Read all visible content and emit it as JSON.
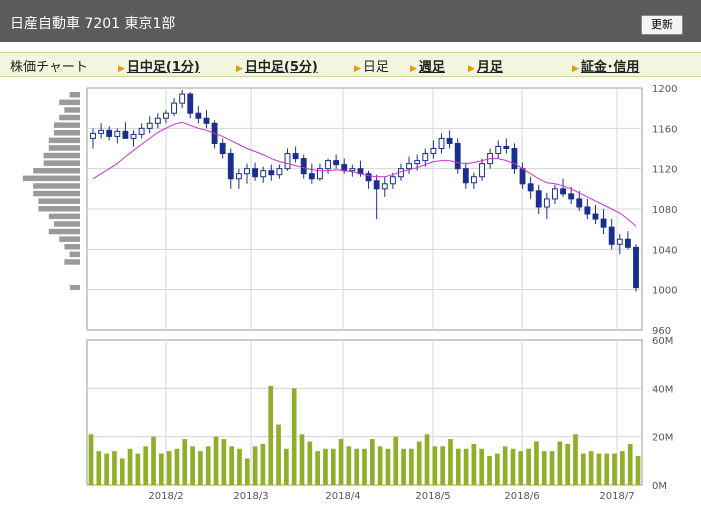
{
  "header": {
    "title": "日産自動車  7201  東京1部",
    "refresh_label": "更新"
  },
  "nav": {
    "label": "株価チャート",
    "items": [
      {
        "label": "日中足(1分)",
        "active": false
      },
      {
        "label": "日中足(5分)",
        "active": false
      },
      {
        "label": "日足",
        "active": true
      },
      {
        "label": "週足",
        "active": false
      },
      {
        "label": "月足",
        "active": false
      },
      {
        "label": "証金･信用",
        "active": false
      }
    ]
  },
  "chart_data": [
    {
      "type": "candlestick",
      "yticks": [
        "1200",
        "1160",
        "1120",
        "1080",
        "1040",
        "1000",
        "960"
      ],
      "ylim": [
        960,
        1200
      ],
      "xticks": [
        "2018/2",
        "2018/3",
        "2018/4",
        "2018/5",
        "2018/6",
        "2018/7"
      ],
      "colors": {
        "up": "#ffffff",
        "down": "#1a2f8c",
        "ma": "#cc33cc"
      },
      "ohlc": [
        [
          1150,
          1160,
          1140,
          1155
        ],
        [
          1155,
          1165,
          1150,
          1158
        ],
        [
          1158,
          1162,
          1148,
          1152
        ],
        [
          1152,
          1160,
          1145,
          1157
        ],
        [
          1157,
          1166,
          1152,
          1150
        ],
        [
          1150,
          1158,
          1142,
          1154
        ],
        [
          1154,
          1165,
          1150,
          1160
        ],
        [
          1160,
          1172,
          1155,
          1165
        ],
        [
          1165,
          1175,
          1160,
          1170
        ],
        [
          1170,
          1178,
          1165,
          1175
        ],
        [
          1175,
          1190,
          1172,
          1185
        ],
        [
          1185,
          1198,
          1180,
          1194
        ],
        [
          1194,
          1196,
          1170,
          1175
        ],
        [
          1175,
          1182,
          1165,
          1170
        ],
        [
          1170,
          1178,
          1160,
          1165
        ],
        [
          1165,
          1168,
          1140,
          1145
        ],
        [
          1145,
          1150,
          1130,
          1135
        ],
        [
          1135,
          1140,
          1100,
          1110
        ],
        [
          1110,
          1120,
          1100,
          1115
        ],
        [
          1115,
          1125,
          1105,
          1120
        ],
        [
          1120,
          1126,
          1108,
          1112
        ],
        [
          1112,
          1122,
          1106,
          1118
        ],
        [
          1118,
          1124,
          1108,
          1114
        ],
        [
          1114,
          1124,
          1110,
          1120
        ],
        [
          1120,
          1140,
          1118,
          1135
        ],
        [
          1135,
          1142,
          1126,
          1130
        ],
        [
          1130,
          1134,
          1110,
          1115
        ],
        [
          1115,
          1125,
          1105,
          1110
        ],
        [
          1110,
          1125,
          1108,
          1120
        ],
        [
          1120,
          1130,
          1115,
          1128
        ],
        [
          1128,
          1134,
          1120,
          1124
        ],
        [
          1124,
          1130,
          1115,
          1118
        ],
        [
          1118,
          1124,
          1112,
          1120
        ],
        [
          1120,
          1128,
          1112,
          1115
        ],
        [
          1115,
          1118,
          1100,
          1108
        ],
        [
          1108,
          1114,
          1070,
          1100
        ],
        [
          1100,
          1112,
          1092,
          1105
        ],
        [
          1105,
          1116,
          1100,
          1112
        ],
        [
          1112,
          1125,
          1108,
          1120
        ],
        [
          1120,
          1132,
          1115,
          1125
        ],
        [
          1125,
          1134,
          1118,
          1128
        ],
        [
          1128,
          1140,
          1122,
          1135
        ],
        [
          1135,
          1148,
          1130,
          1140
        ],
        [
          1140,
          1155,
          1135,
          1150
        ],
        [
          1150,
          1158,
          1140,
          1145
        ],
        [
          1145,
          1150,
          1115,
          1120
        ],
        [
          1120,
          1126,
          1100,
          1106
        ],
        [
          1106,
          1116,
          1100,
          1112
        ],
        [
          1112,
          1130,
          1108,
          1125
        ],
        [
          1125,
          1140,
          1120,
          1135
        ],
        [
          1135,
          1148,
          1130,
          1142
        ],
        [
          1142,
          1150,
          1135,
          1140
        ],
        [
          1140,
          1145,
          1115,
          1120
        ],
        [
          1120,
          1126,
          1100,
          1105
        ],
        [
          1105,
          1112,
          1090,
          1098
        ],
        [
          1098,
          1104,
          1075,
          1082
        ],
        [
          1082,
          1096,
          1070,
          1090
        ],
        [
          1090,
          1104,
          1085,
          1100
        ],
        [
          1100,
          1110,
          1092,
          1095
        ],
        [
          1095,
          1102,
          1085,
          1090
        ],
        [
          1090,
          1098,
          1078,
          1082
        ],
        [
          1082,
          1090,
          1070,
          1075
        ],
        [
          1075,
          1084,
          1065,
          1070
        ],
        [
          1070,
          1080,
          1055,
          1062
        ],
        [
          1062,
          1070,
          1040,
          1045
        ],
        [
          1045,
          1055,
          1035,
          1050
        ],
        [
          1050,
          1058,
          1040,
          1042
        ],
        [
          1042,
          1045,
          998,
          1002
        ]
      ],
      "ma": [
        1110,
        1115,
        1120,
        1125,
        1132,
        1138,
        1144,
        1150,
        1156,
        1160,
        1164,
        1166,
        1163,
        1160,
        1158,
        1155,
        1152,
        1148,
        1144,
        1140,
        1137,
        1134,
        1130,
        1127,
        1125,
        1123,
        1121,
        1119,
        1118,
        1118,
        1119,
        1118,
        1117,
        1115,
        1113,
        1112,
        1112,
        1114,
        1117,
        1119,
        1121,
        1124,
        1127,
        1128,
        1128,
        1126,
        1125,
        1126,
        1128,
        1130,
        1130,
        1128,
        1125,
        1120,
        1115,
        1110,
        1106,
        1105,
        1103,
        1100,
        1096,
        1092,
        1088,
        1084,
        1080,
        1076,
        1070,
        1063
      ]
    },
    {
      "type": "bar",
      "yticks": [
        "60M",
        "40M",
        "20M",
        "0M"
      ],
      "ylim": [
        0,
        60
      ],
      "color": "#8fae2a",
      "values": [
        21,
        14,
        13,
        14,
        11,
        15,
        13,
        16,
        20,
        13,
        14,
        15,
        19,
        16,
        14,
        16,
        20,
        19,
        16,
        15,
        11,
        16,
        17,
        41,
        25,
        15,
        40,
        21,
        18,
        14,
        15,
        15,
        19,
        16,
        15,
        15,
        19,
        16,
        15,
        20,
        15,
        15,
        18,
        21,
        16,
        16,
        19,
        15,
        15,
        17,
        15,
        12,
        13,
        16,
        15,
        14,
        15,
        18,
        14,
        14,
        18,
        17,
        21,
        13,
        14,
        13,
        13,
        13,
        14,
        17,
        12
      ]
    }
  ],
  "volume_profile": {
    "values": [
      2,
      4,
      3,
      4,
      5,
      5,
      6,
      6,
      7,
      7,
      9,
      11,
      9,
      9,
      8,
      8,
      6,
      5,
      6,
      4,
      3,
      2,
      3
    ]
  }
}
